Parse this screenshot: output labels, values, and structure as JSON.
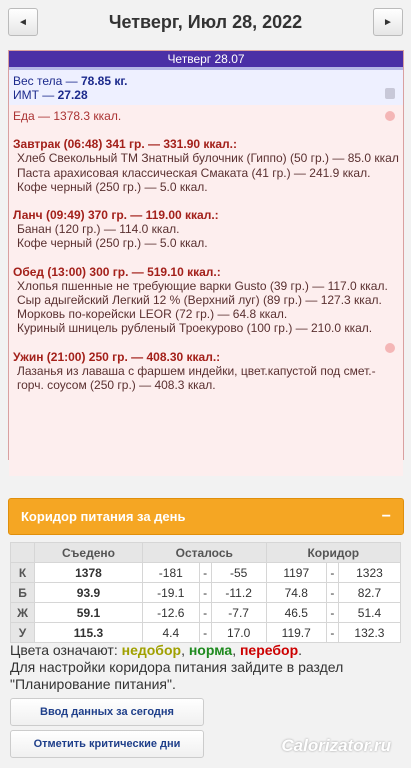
{
  "header": {
    "title": "Четверг, Июл 28, 2022",
    "prev": "◄",
    "next": "►"
  },
  "diary": {
    "day_label": "Четверг 28.07",
    "weight_label": "Вес тела — ",
    "weight_value": "78.85 кг.",
    "bmi_label": "ИМТ — ",
    "bmi_value": "27.28",
    "food_total": "Еда — 1378.3 ккал.",
    "meals": [
      {
        "title": "Завтрак (06:48) 341 гр. — 331.90 ккал.:",
        "items": [
          "Хлеб Свекольный ТМ Знатный булочник (Гиппо) (50 гр.) — 85.0 ккал.",
          "Паста арахисовая классическая Смаката (41 гр.) — 241.9 ккал.",
          "Кофе черный (250 гр.) — 5.0 ккал."
        ]
      },
      {
        "title": "Ланч (09:49) 370 гр. — 119.00 ккал.:",
        "items": [
          "Банан (120 гр.) — 114.0 ккал.",
          "Кофе черный (250 гр.) — 5.0 ккал."
        ]
      },
      {
        "title": "Обед (13:00) 300 гр. — 519.10 ккал.:",
        "items": [
          "Хлопья пшенные не требующие варки Gusto (39 гр.) — 117.0 ккал.",
          "Сыр адыгейский Легкий 12 % (Верхний луг) (89 гр.) — 127.3 ккал.",
          "Морковь по-корейски LEOR (72 гр.) — 64.8 ккал.",
          "Куриный шницель рубленый Троекурово (100 гр.) — 210.0 ккал."
        ]
      },
      {
        "title": "Ужин (21:00) 250 гр. — 408.30 ккал.:",
        "items": [
          "Лазанья из лаваша с фаршем индейки, цвет.капустой под смет.-горч. соусом (250 гр.) — 408.3 ккал."
        ]
      }
    ]
  },
  "corridor": {
    "title": "Коридор питания за день",
    "collapse": "−",
    "headers": [
      "",
      "Съедено",
      "Осталось",
      "Коридор"
    ],
    "rows": [
      {
        "label": "К",
        "eaten": "1378",
        "rem_min": "-181",
        "rem_max": "-55",
        "cor_min": "1197",
        "cor_max": "1323",
        "status": "over"
      },
      {
        "label": "Б",
        "eaten": "93.9",
        "rem_min": "-19.1",
        "rem_max": "-11.2",
        "cor_min": "74.8",
        "cor_max": "82.7",
        "status": "over"
      },
      {
        "label": "Ж",
        "eaten": "59.1",
        "rem_min": "-12.6",
        "rem_max": "-7.7",
        "cor_min": "46.5",
        "cor_max": "51.4",
        "status": "over"
      },
      {
        "label": "У",
        "eaten": "115.3",
        "rem_min": "4.4",
        "rem_max": "17.0",
        "cor_min": "119.7",
        "cor_max": "132.3",
        "status": "under"
      }
    ],
    "dash": "-"
  },
  "legend": {
    "prefix": "Цвета означают: ",
    "under": "недобор",
    "sep1": ", ",
    "norm": "норма",
    "sep2": ", ",
    "over": "перебор",
    "suffix": ".",
    "note": "Для настройки коридора питания зайдите в раздел \"Планирование питания\"."
  },
  "buttons": {
    "enter_data": "Ввод данных за сегодня",
    "mark_critical": "Отметить критические дни"
  },
  "watermark": "Calorizator.ru",
  "colors": {
    "accent": "#f5a623",
    "day_header": "#4b2fa6",
    "over": "#cc0000",
    "under": "#8a8a00",
    "norm": "#1e8a1e"
  }
}
